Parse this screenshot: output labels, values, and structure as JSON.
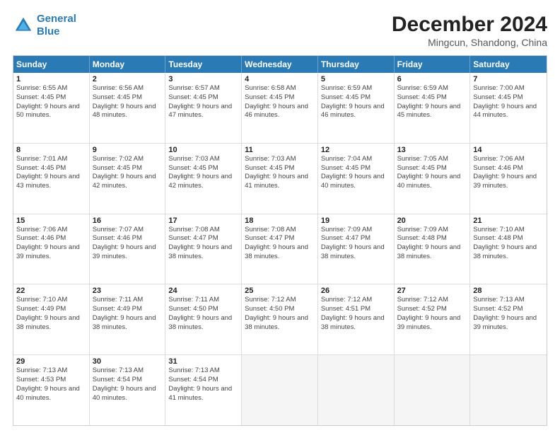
{
  "header": {
    "logo_line1": "General",
    "logo_line2": "Blue",
    "title": "December 2024",
    "subtitle": "Mingcun, Shandong, China"
  },
  "days": [
    "Sunday",
    "Monday",
    "Tuesday",
    "Wednesday",
    "Thursday",
    "Friday",
    "Saturday"
  ],
  "weeks": [
    [
      {
        "day": "1",
        "info": "Sunrise: 6:55 AM\nSunset: 4:45 PM\nDaylight: 9 hours and 50 minutes."
      },
      {
        "day": "2",
        "info": "Sunrise: 6:56 AM\nSunset: 4:45 PM\nDaylight: 9 hours and 48 minutes."
      },
      {
        "day": "3",
        "info": "Sunrise: 6:57 AM\nSunset: 4:45 PM\nDaylight: 9 hours and 47 minutes."
      },
      {
        "day": "4",
        "info": "Sunrise: 6:58 AM\nSunset: 4:45 PM\nDaylight: 9 hours and 46 minutes."
      },
      {
        "day": "5",
        "info": "Sunrise: 6:59 AM\nSunset: 4:45 PM\nDaylight: 9 hours and 46 minutes."
      },
      {
        "day": "6",
        "info": "Sunrise: 6:59 AM\nSunset: 4:45 PM\nDaylight: 9 hours and 45 minutes."
      },
      {
        "day": "7",
        "info": "Sunrise: 7:00 AM\nSunset: 4:45 PM\nDaylight: 9 hours and 44 minutes."
      }
    ],
    [
      {
        "day": "8",
        "info": "Sunrise: 7:01 AM\nSunset: 4:45 PM\nDaylight: 9 hours and 43 minutes."
      },
      {
        "day": "9",
        "info": "Sunrise: 7:02 AM\nSunset: 4:45 PM\nDaylight: 9 hours and 42 minutes."
      },
      {
        "day": "10",
        "info": "Sunrise: 7:03 AM\nSunset: 4:45 PM\nDaylight: 9 hours and 42 minutes."
      },
      {
        "day": "11",
        "info": "Sunrise: 7:03 AM\nSunset: 4:45 PM\nDaylight: 9 hours and 41 minutes."
      },
      {
        "day": "12",
        "info": "Sunrise: 7:04 AM\nSunset: 4:45 PM\nDaylight: 9 hours and 40 minutes."
      },
      {
        "day": "13",
        "info": "Sunrise: 7:05 AM\nSunset: 4:45 PM\nDaylight: 9 hours and 40 minutes."
      },
      {
        "day": "14",
        "info": "Sunrise: 7:06 AM\nSunset: 4:46 PM\nDaylight: 9 hours and 39 minutes."
      }
    ],
    [
      {
        "day": "15",
        "info": "Sunrise: 7:06 AM\nSunset: 4:46 PM\nDaylight: 9 hours and 39 minutes."
      },
      {
        "day": "16",
        "info": "Sunrise: 7:07 AM\nSunset: 4:46 PM\nDaylight: 9 hours and 39 minutes."
      },
      {
        "day": "17",
        "info": "Sunrise: 7:08 AM\nSunset: 4:47 PM\nDaylight: 9 hours and 38 minutes."
      },
      {
        "day": "18",
        "info": "Sunrise: 7:08 AM\nSunset: 4:47 PM\nDaylight: 9 hours and 38 minutes."
      },
      {
        "day": "19",
        "info": "Sunrise: 7:09 AM\nSunset: 4:47 PM\nDaylight: 9 hours and 38 minutes."
      },
      {
        "day": "20",
        "info": "Sunrise: 7:09 AM\nSunset: 4:48 PM\nDaylight: 9 hours and 38 minutes."
      },
      {
        "day": "21",
        "info": "Sunrise: 7:10 AM\nSunset: 4:48 PM\nDaylight: 9 hours and 38 minutes."
      }
    ],
    [
      {
        "day": "22",
        "info": "Sunrise: 7:10 AM\nSunset: 4:49 PM\nDaylight: 9 hours and 38 minutes."
      },
      {
        "day": "23",
        "info": "Sunrise: 7:11 AM\nSunset: 4:49 PM\nDaylight: 9 hours and 38 minutes."
      },
      {
        "day": "24",
        "info": "Sunrise: 7:11 AM\nSunset: 4:50 PM\nDaylight: 9 hours and 38 minutes."
      },
      {
        "day": "25",
        "info": "Sunrise: 7:12 AM\nSunset: 4:50 PM\nDaylight: 9 hours and 38 minutes."
      },
      {
        "day": "26",
        "info": "Sunrise: 7:12 AM\nSunset: 4:51 PM\nDaylight: 9 hours and 38 minutes."
      },
      {
        "day": "27",
        "info": "Sunrise: 7:12 AM\nSunset: 4:52 PM\nDaylight: 9 hours and 39 minutes."
      },
      {
        "day": "28",
        "info": "Sunrise: 7:13 AM\nSunset: 4:52 PM\nDaylight: 9 hours and 39 minutes."
      }
    ],
    [
      {
        "day": "29",
        "info": "Sunrise: 7:13 AM\nSunset: 4:53 PM\nDaylight: 9 hours and 40 minutes."
      },
      {
        "day": "30",
        "info": "Sunrise: 7:13 AM\nSunset: 4:54 PM\nDaylight: 9 hours and 40 minutes."
      },
      {
        "day": "31",
        "info": "Sunrise: 7:13 AM\nSunset: 4:54 PM\nDaylight: 9 hours and 41 minutes."
      },
      {
        "day": "",
        "info": ""
      },
      {
        "day": "",
        "info": ""
      },
      {
        "day": "",
        "info": ""
      },
      {
        "day": "",
        "info": ""
      }
    ]
  ]
}
